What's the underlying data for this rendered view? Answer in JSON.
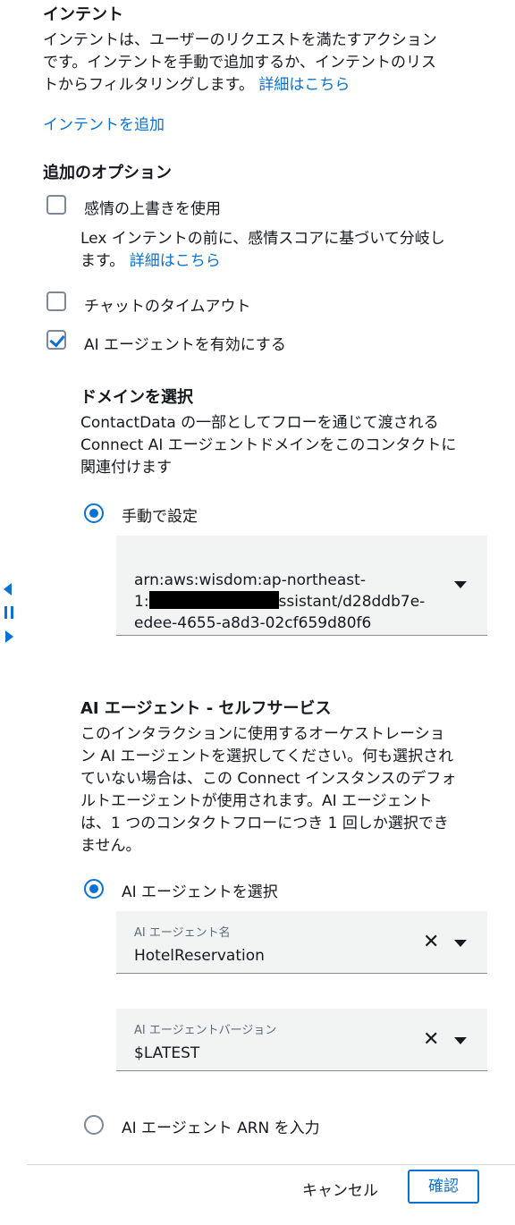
{
  "intent": {
    "title": "インテント",
    "desc_line1": "インテントは、ユーザーのリクエストを満たすアクション",
    "desc_line2": "です。インテントを手動で追加するか、インテントのリス",
    "desc_line3": "トからフィルタリングします。",
    "learn_more": "詳細はこちら",
    "add_link": "インテントを追加"
  },
  "options": {
    "title": "追加のオプション",
    "sentiment": {
      "label": "感情の上書きを使用",
      "checked": false,
      "desc_line1": "Lex インテントの前に、感情スコアに基づいて分岐し",
      "desc_line2": "ます。",
      "learn_more": "詳細はこちら"
    },
    "chat_timeout": {
      "label": "チャットのタイムアウト",
      "checked": false
    },
    "ai_agent": {
      "label": "AI エージェントを有効にする",
      "checked": true
    }
  },
  "domain": {
    "title": "ドメインを選択",
    "desc_line1": "ContactData の一部としてフローを通じて渡される",
    "desc_line2": "Connect AI エージェントドメインをこのコンタクトに",
    "desc_line3": "関連付けます",
    "manual_label": "手動で設定",
    "arn_line1": "arn:aws:wisdom:ap-northeast-",
    "arn_line2_prefix": "1:",
    "arn_line2_suffix": "ssistant/d28ddb7e-",
    "arn_line3": "edee-4655-a8d3-02cf659d80f6"
  },
  "self_service": {
    "title": "AI エージェント - セルフサービス",
    "desc_line1": "このインタラクションに使用するオーケストレーショ",
    "desc_line2": "ン AI エージェントを選択してください。何も選択され",
    "desc_line3": "ていない場合は、この Connect インスタンスのデフォ",
    "desc_line4": "ルトエージェントが使用されます。AI エージェント",
    "desc_line5": "は、1 つのコンタクトフローにつき 1 回しか選択でき",
    "desc_line6": "ません。",
    "select_radio": "AI エージェントを選択",
    "agent_name_label": "AI エージェント名",
    "agent_name_value": "HotelReservation",
    "agent_version_label": "AI エージェントバージョン",
    "agent_version_value": "$LATEST",
    "arn_radio": "AI エージェント ARN を入力"
  },
  "footer": {
    "cancel": "キャンセル",
    "confirm": "確認"
  },
  "colors": {
    "accent": "#0972d3",
    "text": "#16191f",
    "field_bg": "#f2f3f3"
  }
}
